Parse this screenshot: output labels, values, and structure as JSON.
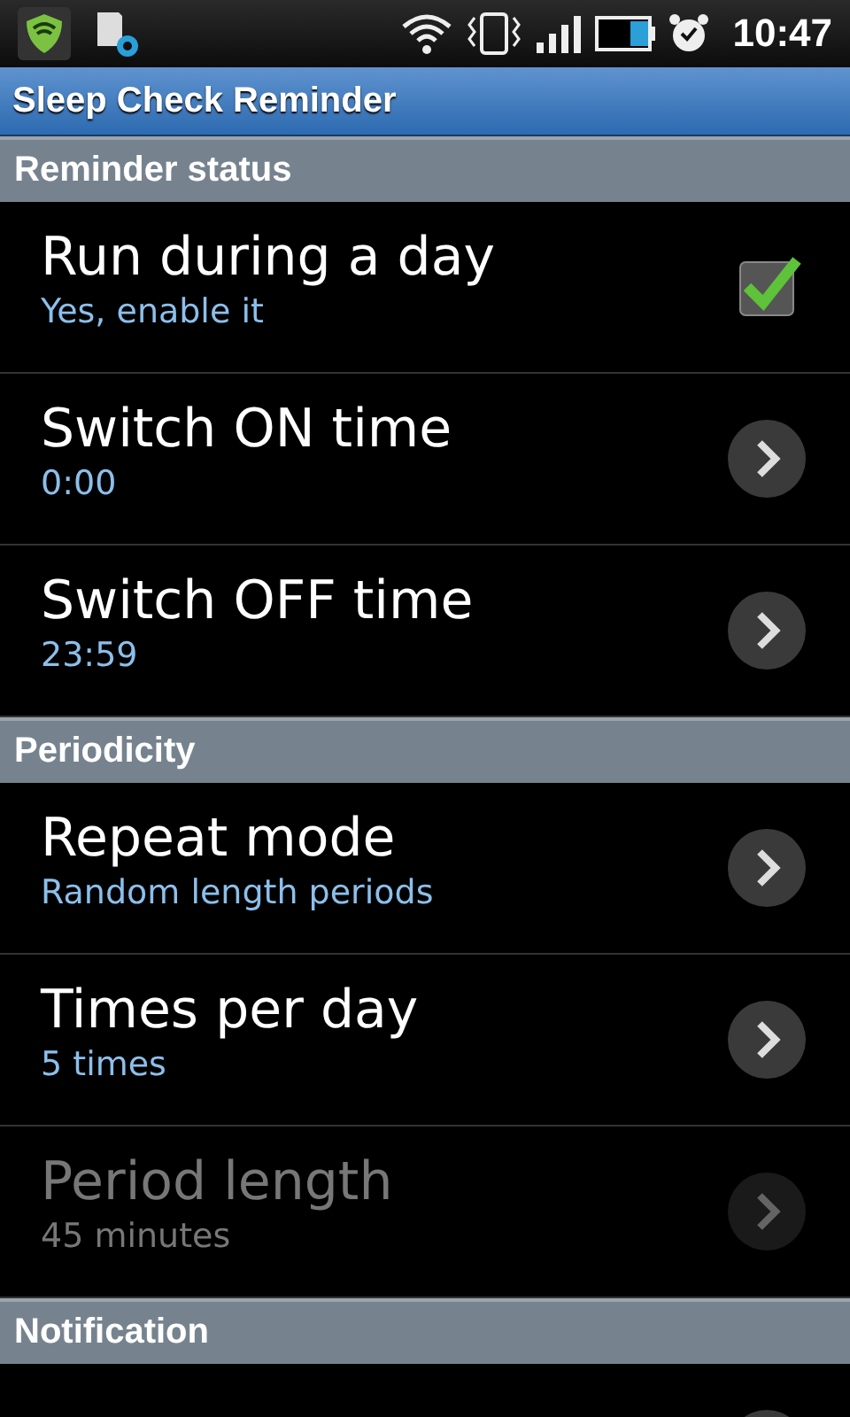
{
  "status_bar": {
    "time": "10:47"
  },
  "title_bar": {
    "title": "Sleep Check Reminder"
  },
  "sections": [
    {
      "header": "Reminder status",
      "items": [
        {
          "kind": "checkbox",
          "title": "Run during a day",
          "summary": "Yes, enable it",
          "checked": true,
          "disabled": false
        },
        {
          "kind": "link",
          "title": "Switch ON time",
          "summary": "0:00",
          "disabled": false
        },
        {
          "kind": "link",
          "title": "Switch OFF time",
          "summary": "23:59",
          "disabled": false
        }
      ]
    },
    {
      "header": "Periodicity",
      "items": [
        {
          "kind": "link",
          "title": "Repeat mode",
          "summary": "Random length periods",
          "disabled": false
        },
        {
          "kind": "link",
          "title": "Times per day",
          "summary": "5 times",
          "disabled": false
        },
        {
          "kind": "link",
          "title": "Period length",
          "summary": "45 minutes",
          "disabled": true
        }
      ]
    },
    {
      "header": "Notification",
      "items": [
        {
          "kind": "link",
          "disabled": false
        }
      ]
    }
  ]
}
